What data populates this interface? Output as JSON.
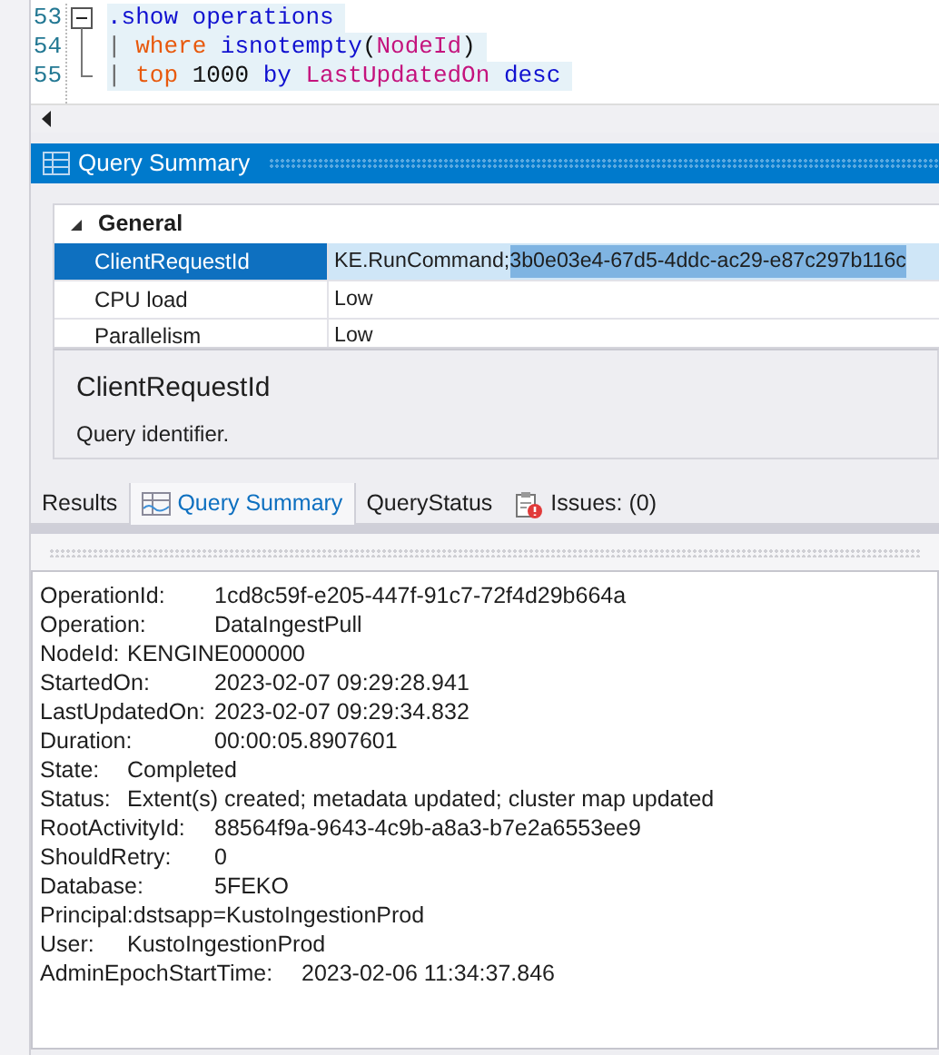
{
  "editor": {
    "lines": [
      {
        "number": "53",
        "tokens": [
          {
            "text": ".show operations",
            "kind": "keyword"
          }
        ]
      },
      {
        "number": "54",
        "tokens": [
          {
            "text": "| ",
            "kind": "pipe"
          },
          {
            "text": "where ",
            "kind": "operator"
          },
          {
            "text": "isnotempty",
            "kind": "keyword"
          },
          {
            "text": "(",
            "kind": "plain"
          },
          {
            "text": "NodeId",
            "kind": "column"
          },
          {
            "text": ")",
            "kind": "plain"
          }
        ]
      },
      {
        "number": "55",
        "tokens": [
          {
            "text": "| ",
            "kind": "pipe"
          },
          {
            "text": "top",
            "kind": "operator"
          },
          {
            "text": " 1000 ",
            "kind": "plain"
          },
          {
            "text": "by ",
            "kind": "keyword"
          },
          {
            "text": "LastUpdatedOn ",
            "kind": "column"
          },
          {
            "text": "desc",
            "kind": "keyword"
          }
        ]
      }
    ]
  },
  "summary_panel": {
    "title": "Query Summary",
    "property_grid": {
      "category": "General",
      "expanded": true,
      "rows": [
        {
          "name": "ClientRequestId",
          "selected": true,
          "value_parts": [
            {
              "text": "KE.RunCommand;",
              "highlighted": false
            },
            {
              "text": "3b0e03e4-67d5-4ddc-ac29-e87c297b116c",
              "highlighted": true
            }
          ]
        },
        {
          "name": "CPU load",
          "selected": false,
          "value_parts": [
            {
              "text": "Low",
              "highlighted": false
            }
          ]
        },
        {
          "name": "Parallelism",
          "selected": false,
          "value_parts": [
            {
              "text": "Low",
              "highlighted": false
            }
          ]
        }
      ]
    },
    "description": {
      "title": "ClientRequestId",
      "text": "Query identifier."
    }
  },
  "tabs": [
    {
      "label": "Results",
      "kind": "plain",
      "selected": false
    },
    {
      "label": "Query Summary",
      "kind": "summary",
      "selected": true
    },
    {
      "label": "QueryStatus",
      "kind": "plain",
      "selected": false
    },
    {
      "label": "Issues: (0)",
      "kind": "issues",
      "selected": false
    }
  ],
  "details": [
    "OperationId:\t1cd8c59f-e205-447f-91c7-72f4d29b664a",
    "Operation:\tDataIngestPull",
    "NodeId:\tKENGINE000000",
    "StartedOn:\t2023-02-07 09:29:28.941",
    "LastUpdatedOn:\t2023-02-07 09:29:34.832",
    "Duration:\t00:00:05.8907601",
    "State:\tCompleted",
    "Status:\tExtent(s) created; metadata updated; cluster map updated",
    "RootActivityId:\t88564f9a-9643-4c9b-a8a3-b7e2a6553ee9",
    "ShouldRetry:\t0",
    "Database:\t5FEKO",
    "Principal:dstsapp=KustoIngestionProd",
    "User:\tKustoIngestionProd",
    "AdminEpochStartTime:\t2023-02-06 11:34:37.846"
  ]
}
